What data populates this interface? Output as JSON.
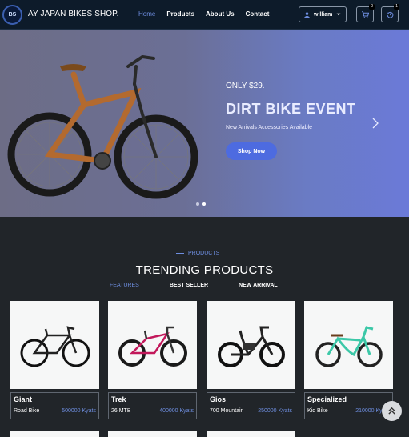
{
  "nav": {
    "brand": "AY JAPAN BIKES SHOP.",
    "logo_text": "BS",
    "links": [
      "Home",
      "Products",
      "About Us",
      "Contact"
    ],
    "active_link": "Home",
    "user_label": "william",
    "cart_count": "0",
    "history_count": "1",
    "icons": [
      "user-icon",
      "caret-down-icon",
      "cart-icon",
      "history-icon"
    ]
  },
  "hero": {
    "price": "ONLY $29.",
    "title": "DIRT BIKE EVENT",
    "subtitle": "New Arrivals Accessories Available",
    "button": "Shop Now",
    "slide_dots": 2,
    "active_slide": 2
  },
  "products": {
    "tag": "PRODUCTS",
    "title": "TRENDING PRODUCTS",
    "tabs": [
      "FEATURES",
      "BEST SELLER",
      "NEW ARRIVAL"
    ],
    "active_tab": "FEATURES",
    "items": [
      {
        "name": "Giant",
        "type": "Road Bike",
        "price": "500000 Kyats"
      },
      {
        "name": "Trek",
        "type": "26 MTB",
        "price": "400000 Kyats"
      },
      {
        "name": "Gios",
        "type": "700 Mountain",
        "price": "250000 Kyats"
      },
      {
        "name": "Specialized",
        "type": "Kid Bike",
        "price": "210000 Kyats"
      }
    ]
  },
  "colors": {
    "accent": "#6e8ee0",
    "nav_bg": "#0d1b2a",
    "page_bg": "#212529",
    "button": "#4d6be0"
  }
}
